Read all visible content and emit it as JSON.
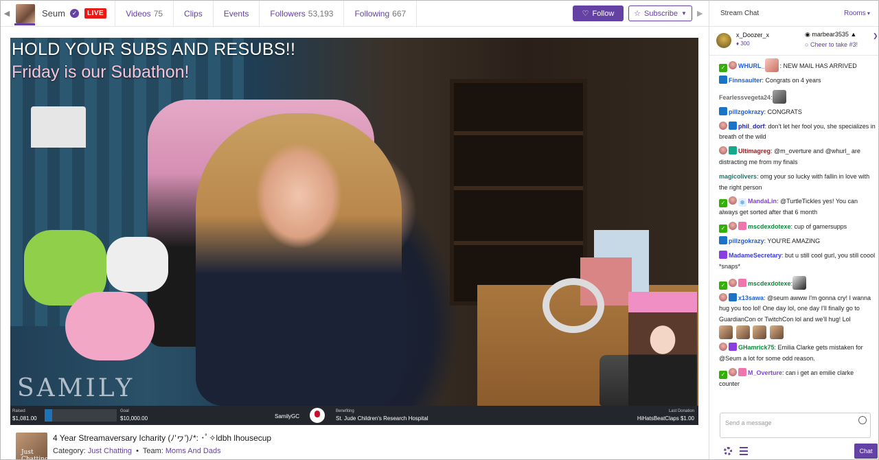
{
  "channel": {
    "name": "Seum",
    "live_label": "LIVE"
  },
  "nav": {
    "videos": {
      "label": "Videos",
      "count": "75"
    },
    "clips": {
      "label": "Clips"
    },
    "events": {
      "label": "Events"
    },
    "followers": {
      "label": "Followers",
      "count": "53,193"
    },
    "following": {
      "label": "Following",
      "count": "667"
    }
  },
  "actions": {
    "follow": "Follow",
    "subscribe": "Subscribe"
  },
  "overlay": {
    "line1": "HOLD YOUR SUBS AND RESUBS!!",
    "line2": "Friday is our Subathon!",
    "logo": "SAMILY",
    "charity": {
      "raised_label": "Raised",
      "raised_value": "$1,081.00",
      "goal_label": "Goal",
      "goal_value": "$10,000.00",
      "progress_fraction": 0.108,
      "team": "SamilyGC",
      "benefiting_label": "Benefiting",
      "benefiting_name": "St. Jude Children's Research Hospital",
      "last_label": "Last Donation",
      "last_value": "HiHatsBeatClaps $1.00"
    }
  },
  "stream": {
    "thumb_text": "Just Chatting",
    "title": "4 Year Streamaversary Icharity (ﾉ'ヮ')ﾉ*: ･ﾟ✧ldbh lhousecup",
    "category_label": "Category:",
    "category": "Just Chatting",
    "team_label": "Team:",
    "team": "Moms And Dads"
  },
  "chat": {
    "header": "Stream Chat",
    "rooms": "Rooms",
    "pinned": {
      "left_name": "x_Doozer_x",
      "left_bits": "300",
      "right_name": "marbear3535",
      "right_cta": "Cheer to take #3!"
    },
    "messages": [
      {
        "user": "WHURL_",
        "text": ": NEW  MAIL  HAS  ARRIVED",
        "color": "#1e5fd6"
      },
      {
        "user": "Finnsaulter",
        "text": ": Congrats on 4 years",
        "color": "#1e5fd6"
      },
      {
        "user": "Fearlessvegeta24",
        "text": ":",
        "color": "#6a6a6a"
      },
      {
        "user": "pillzgokrazy",
        "text": ": CONGRATS",
        "color": "#1e5fd6"
      },
      {
        "user": "phil_dorf",
        "text": ": don't let her fool you, she specializes in breath of the wild",
        "color": "#1e1eb4"
      },
      {
        "user": "Ultimagreg",
        "text": ": @m_overture and @whurl_ are distracting me from my finals",
        "color": "#8b1d1d"
      },
      {
        "user": "magicolivers",
        "text": ": omg your so lucky with fallin in love with the right person",
        "color": "#1a7a6c"
      },
      {
        "user": "MandaLin",
        "text": ": @TurtleTickles yes! You can always get sorted after that 6 month",
        "color": "#8a3de0"
      },
      {
        "user": "mscdexdotexe",
        "text": ": cup of gamersupps",
        "color": "#0c8a3a"
      },
      {
        "user": "pillzgokrazy",
        "text": ": YOU'RE AMAZING",
        "color": "#1e5fd6"
      },
      {
        "user": "MadameSecretary",
        "text": ": but u still cool gurl, you still coool *snaps*",
        "color": "#3a3ad8"
      },
      {
        "user": "mscdexdotexe",
        "text": ":",
        "color": "#0c8a3a"
      },
      {
        "user": "x13sawa",
        "text": ": @seum awww I'm gonna cry! I wanna hug you too lol! One day lol, one day I'll finally go to GuardianCon or TwitchCon lol and we'll hug! Lol",
        "color": "#1e5fd6"
      },
      {
        "user": "GHamrick75",
        "text": ": Emilia Clarke gets mistaken for @Seum a lot for some odd reason.",
        "color": "#0c8a3a"
      },
      {
        "user": "M_Overture",
        "text": ": can i get an emilie clarke counter",
        "color": "#8a3de0"
      }
    ],
    "input_placeholder": "Send a message",
    "send_label": "Chat"
  }
}
